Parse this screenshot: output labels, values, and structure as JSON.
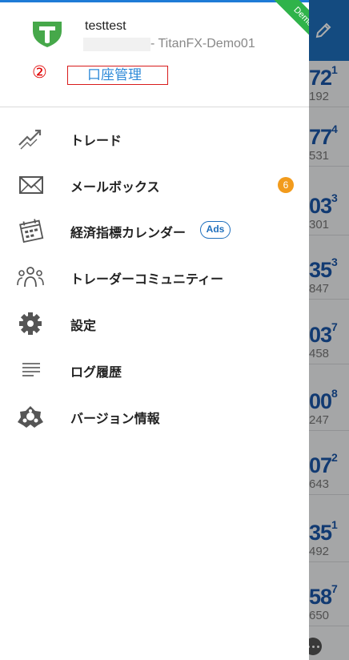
{
  "account": {
    "name": "testtest",
    "server": "- TitanFX-Demo01",
    "demo_label": "Demo"
  },
  "annotation": {
    "marker": "②",
    "manage_label": "口座管理"
  },
  "menu": {
    "items": [
      {
        "label": "トレード",
        "icon": "trade-chart-icon"
      },
      {
        "label": "メールボックス",
        "icon": "mail-icon",
        "badge": "6"
      },
      {
        "label": "経済指標カレンダー",
        "icon": "calendar-icon",
        "tag": "Ads"
      },
      {
        "label": "トレーダーコミュニティー",
        "icon": "community-icon"
      },
      {
        "label": "設定",
        "icon": "gear-icon"
      },
      {
        "label": "ログ履歴",
        "icon": "log-list-icon"
      },
      {
        "label": "バージョン情報",
        "icon": "version-info-icon"
      }
    ]
  },
  "background": {
    "quotes": [
      {
        "big": "72",
        "sup": "1",
        "small": "192"
      },
      {
        "big": "77",
        "sup": "4",
        "small": "531"
      },
      {
        "big": "03",
        "sup": "3",
        "small": "301"
      },
      {
        "big": "35",
        "sup": "3",
        "small": "847"
      },
      {
        "big": "03",
        "sup": "7",
        "small": "458"
      },
      {
        "big": "00",
        "sup": "8",
        "small": "247"
      },
      {
        "big": "07",
        "sup": "2",
        "small": "643"
      },
      {
        "big": "35",
        "sup": "1",
        "small": "492"
      },
      {
        "big": "58",
        "sup": "7",
        "small": "650"
      }
    ]
  },
  "colors": {
    "accent": "#1e6fbd",
    "link": "#2e8ad8",
    "badge": "#f29b1c",
    "demo": "#2fb34a",
    "logo": "#46a84a",
    "annotation": "#d81b1b"
  }
}
